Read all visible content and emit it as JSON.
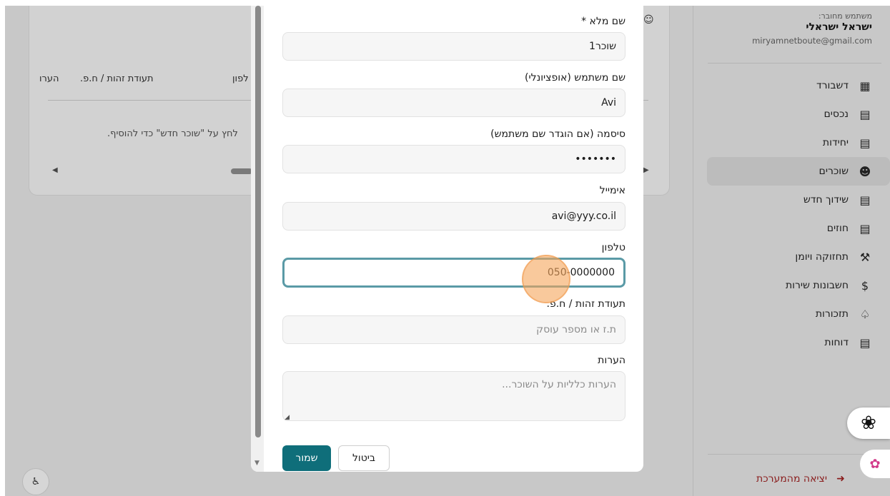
{
  "background": {
    "table_headers": [
      "הערות",
      "תעודת זהות / ח.פ.",
      "טלפון"
    ],
    "header_phone_partial": "לפון",
    "header_notes_partial": "הערו",
    "empty_message": "לחץ על \"שוכר חדש\" כדי להוסיף."
  },
  "sidebar": {
    "user_caption": "משתמש מחובר:",
    "user_name": "ישראל ישראלי",
    "user_email": "miryamnetboute@gmail.com",
    "items": [
      {
        "label": "דשבורד",
        "icon": "grid-icon"
      },
      {
        "label": "נכסים",
        "icon": "building-icon"
      },
      {
        "label": "יחידות",
        "icon": "building-icon"
      },
      {
        "label": "שוכרים",
        "icon": "users-icon",
        "active": true
      },
      {
        "label": "שידוך חדש",
        "icon": "document-icon"
      },
      {
        "label": "חוזים",
        "icon": "document-icon"
      },
      {
        "label": "תחזוקה ויומן",
        "icon": "wrench-icon"
      },
      {
        "label": "חשבונות שירות",
        "icon": "dollar-icon"
      },
      {
        "label": "תזכורות",
        "icon": "bell-icon"
      },
      {
        "label": "דוחות",
        "icon": "report-icon"
      }
    ],
    "logout_label": "יציאה מהמערכת"
  },
  "form": {
    "full_name_label": "שם מלא *",
    "full_name_value": "שוכר1",
    "username_label": "שם משתמש (אופציונלי)",
    "username_value": "Avi",
    "password_label": "סיסמה (אם הוגדר שם משתמש)",
    "password_value": "•••••••",
    "email_label": "אימייל",
    "email_value": "avi@yyy.co.il",
    "phone_label": "טלפון",
    "phone_value": "050-0000000",
    "id_label": "תעודת זהות / ח.פ.",
    "id_placeholder": "ת.ז או מספר עוסק",
    "notes_label": "הערות",
    "notes_placeholder": "הערות כלליות על השוכר...",
    "save_label": "שמור",
    "cancel_label": "ביטול"
  }
}
